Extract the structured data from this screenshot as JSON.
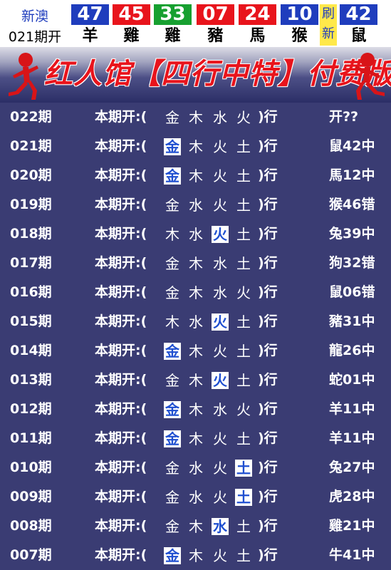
{
  "header": {
    "brand_line1": "新澳",
    "brand_line2": "021期开",
    "refresh_chars": [
      "刷",
      "新"
    ],
    "balls": [
      {
        "number": "47",
        "zodiac": "羊",
        "color": "#1f3dbd"
      },
      {
        "number": "45",
        "zodiac": "雞",
        "color": "#e8141c"
      },
      {
        "number": "33",
        "zodiac": "雞",
        "color": "#17a030"
      },
      {
        "number": "07",
        "zodiac": "豬",
        "color": "#e8141c"
      },
      {
        "number": "24",
        "zodiac": "馬",
        "color": "#e8141c"
      },
      {
        "number": "10",
        "zodiac": "猴",
        "color": "#1f3dbd"
      },
      {
        "number": "42",
        "zodiac": "鼠",
        "color": "#1f3dbd"
      }
    ]
  },
  "banner": {
    "title": "红人馆【四行中特】付费版"
  },
  "rows": [
    {
      "period": "022期",
      "lead": "本期开:(",
      "elements": [
        "金",
        "木",
        "水",
        "火"
      ],
      "highlight": -1,
      "close": ")行",
      "result": "开??"
    },
    {
      "period": "021期",
      "lead": "本期开:(",
      "elements": [
        "金",
        "木",
        "火",
        "土"
      ],
      "highlight": 0,
      "close": ")行",
      "result": "鼠42中"
    },
    {
      "period": "020期",
      "lead": "本期开:(",
      "elements": [
        "金",
        "木",
        "火",
        "土"
      ],
      "highlight": 0,
      "close": ")行",
      "result": "馬12中"
    },
    {
      "period": "019期",
      "lead": "本期开:(",
      "elements": [
        "金",
        "水",
        "火",
        "土"
      ],
      "highlight": -1,
      "close": ")行",
      "result": "猴46错"
    },
    {
      "period": "018期",
      "lead": "本期开:(",
      "elements": [
        "木",
        "水",
        "火",
        "土"
      ],
      "highlight": 2,
      "close": ")行",
      "result": "兔39中"
    },
    {
      "period": "017期",
      "lead": "本期开:(",
      "elements": [
        "金",
        "木",
        "水",
        "土"
      ],
      "highlight": -1,
      "close": ")行",
      "result": "狗32错"
    },
    {
      "period": "016期",
      "lead": "本期开:(",
      "elements": [
        "金",
        "木",
        "水",
        "火"
      ],
      "highlight": -1,
      "close": ")行",
      "result": "鼠06错"
    },
    {
      "period": "015期",
      "lead": "本期开:(",
      "elements": [
        "木",
        "水",
        "火",
        "土"
      ],
      "highlight": 2,
      "close": ")行",
      "result": "豬31中"
    },
    {
      "period": "014期",
      "lead": "本期开:(",
      "elements": [
        "金",
        "木",
        "火",
        "土"
      ],
      "highlight": 0,
      "close": ")行",
      "result": "龍26中"
    },
    {
      "period": "013期",
      "lead": "本期开:(",
      "elements": [
        "金",
        "木",
        "火",
        "土"
      ],
      "highlight": 2,
      "close": ")行",
      "result": "蛇01中"
    },
    {
      "period": "012期",
      "lead": "本期开:(",
      "elements": [
        "金",
        "木",
        "水",
        "火"
      ],
      "highlight": 0,
      "close": ")行",
      "result": "羊11中"
    },
    {
      "period": "011期",
      "lead": "本期开:(",
      "elements": [
        "金",
        "木",
        "火",
        "土"
      ],
      "highlight": 0,
      "close": ")行",
      "result": "羊11中"
    },
    {
      "period": "010期",
      "lead": "本期开:(",
      "elements": [
        "金",
        "水",
        "火",
        "土"
      ],
      "highlight": 3,
      "close": ")行",
      "result": "兔27中"
    },
    {
      "period": "009期",
      "lead": "本期开:(",
      "elements": [
        "金",
        "水",
        "火",
        "土"
      ],
      "highlight": 3,
      "close": ")行",
      "result": "虎28中"
    },
    {
      "period": "008期",
      "lead": "本期开:(",
      "elements": [
        "金",
        "木",
        "水",
        "土"
      ],
      "highlight": 2,
      "close": ")行",
      "result": "雞21中"
    },
    {
      "period": "007期",
      "lead": "本期开:(",
      "elements": [
        "金",
        "木",
        "火",
        "土"
      ],
      "highlight": 0,
      "close": ")行",
      "result": "牛41中"
    }
  ]
}
